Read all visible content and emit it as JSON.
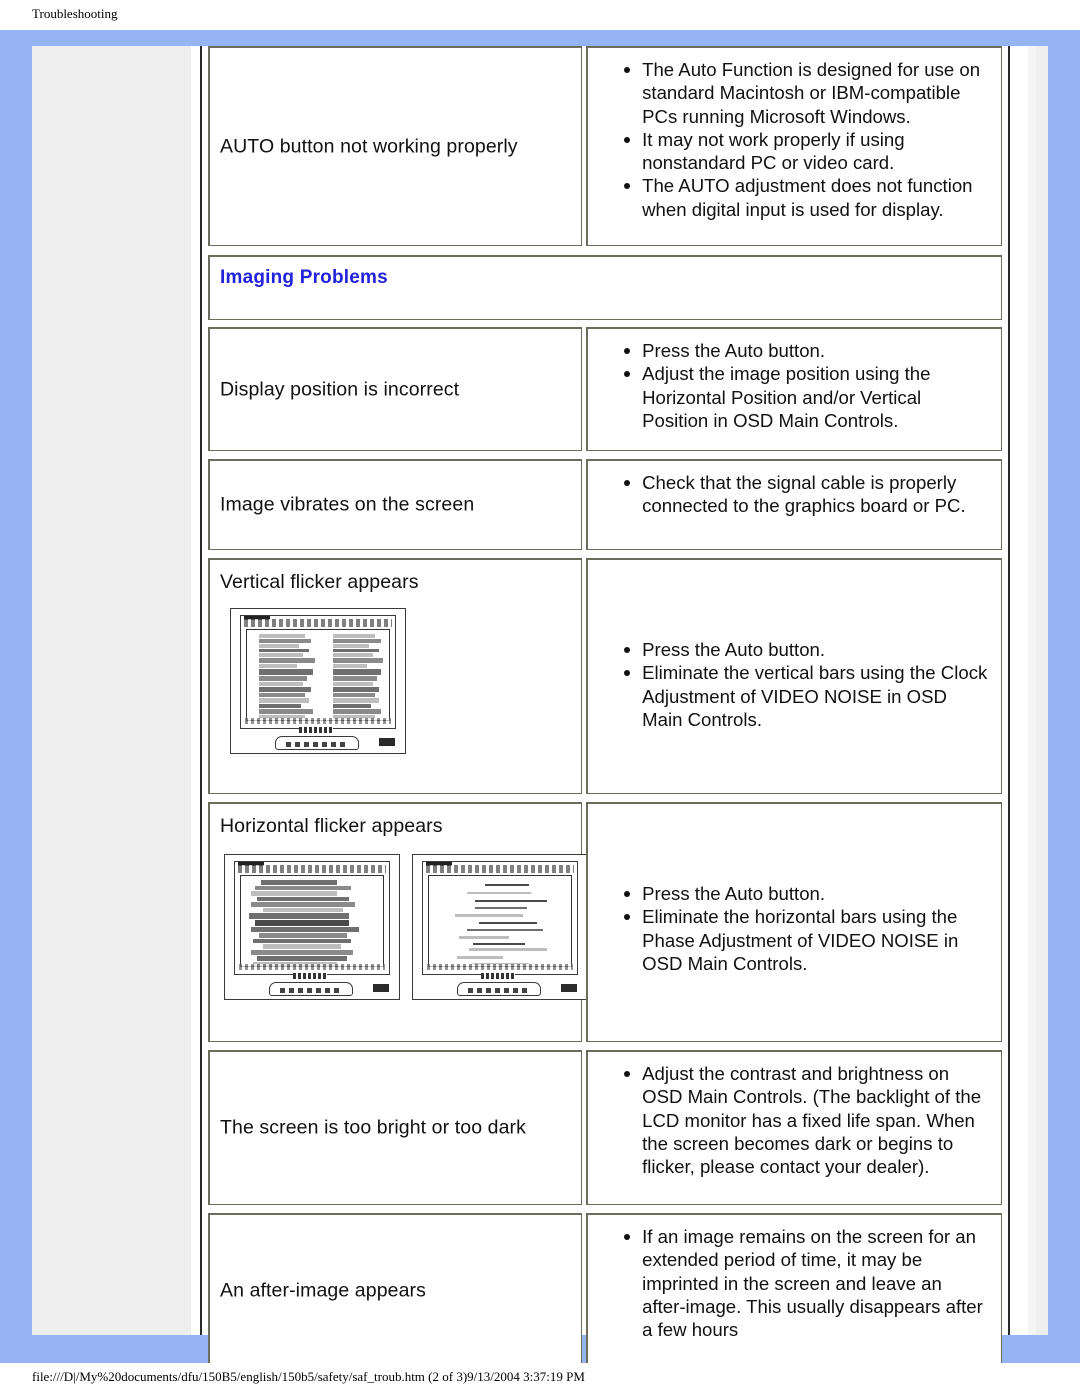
{
  "print": {
    "header": "Troubleshooting",
    "footer": "file:///D|/My%20documents/dfu/150B5/english/150b5/safety/saf_troub.htm (2 of 3)9/13/2004 3:37:19 PM"
  },
  "colors": {
    "page_background": "#96b4f4",
    "sheet": "#ffffff",
    "nav_column": "#eeeeee",
    "section_heading": "#2222dd",
    "cell_border": "#6b6b5e"
  },
  "section": {
    "heading": "Imaging Problems"
  },
  "rows": [
    {
      "symptom": "AUTO button not working properly",
      "solutions": [
        "The Auto Function is designed for use on standard Macintosh or IBM-compatible PCs running Microsoft Windows.",
        "It may not work properly if using nonstandard PC or video card.",
        "The AUTO adjustment does not function when digital input is used for display."
      ]
    },
    {
      "symptom": "Display position is incorrect",
      "solutions": [
        "Press the Auto button.",
        "Adjust the image position using the Horizontal Position and/or Vertical Position in OSD Main Controls."
      ]
    },
    {
      "symptom": "Image vibrates on the screen",
      "solutions": [
        "Check that the signal cable is properly connected to the graphics board or PC."
      ]
    },
    {
      "symptom": "Vertical flicker appears",
      "solutions": [
        "Press the Auto button.",
        "Eliminate the vertical bars using the Clock Adjustment of VIDEO NOISE in OSD Main Controls."
      ],
      "illustration": "monitor-vertical-noise"
    },
    {
      "symptom": "Horizontal flicker appears",
      "solutions": [
        "Press the Auto button.",
        "Eliminate the horizontal bars using the Phase Adjustment of VIDEO NOISE in OSD Main Controls."
      ],
      "illustration": "monitor-horizontal-noise-pair"
    },
    {
      "symptom": "The screen is too bright or too dark",
      "solutions": [
        "Adjust the contrast and brightness on OSD Main Controls. (The backlight of the LCD monitor has a fixed life span. When the screen becomes dark or begins to flicker, please contact your dealer)."
      ]
    },
    {
      "symptom": "An after-image appears",
      "solutions": [
        "If an image remains on the screen for an extended period of time, it may be imprinted in the screen and leave an after-image. This usually disappears after a few hours"
      ]
    }
  ]
}
